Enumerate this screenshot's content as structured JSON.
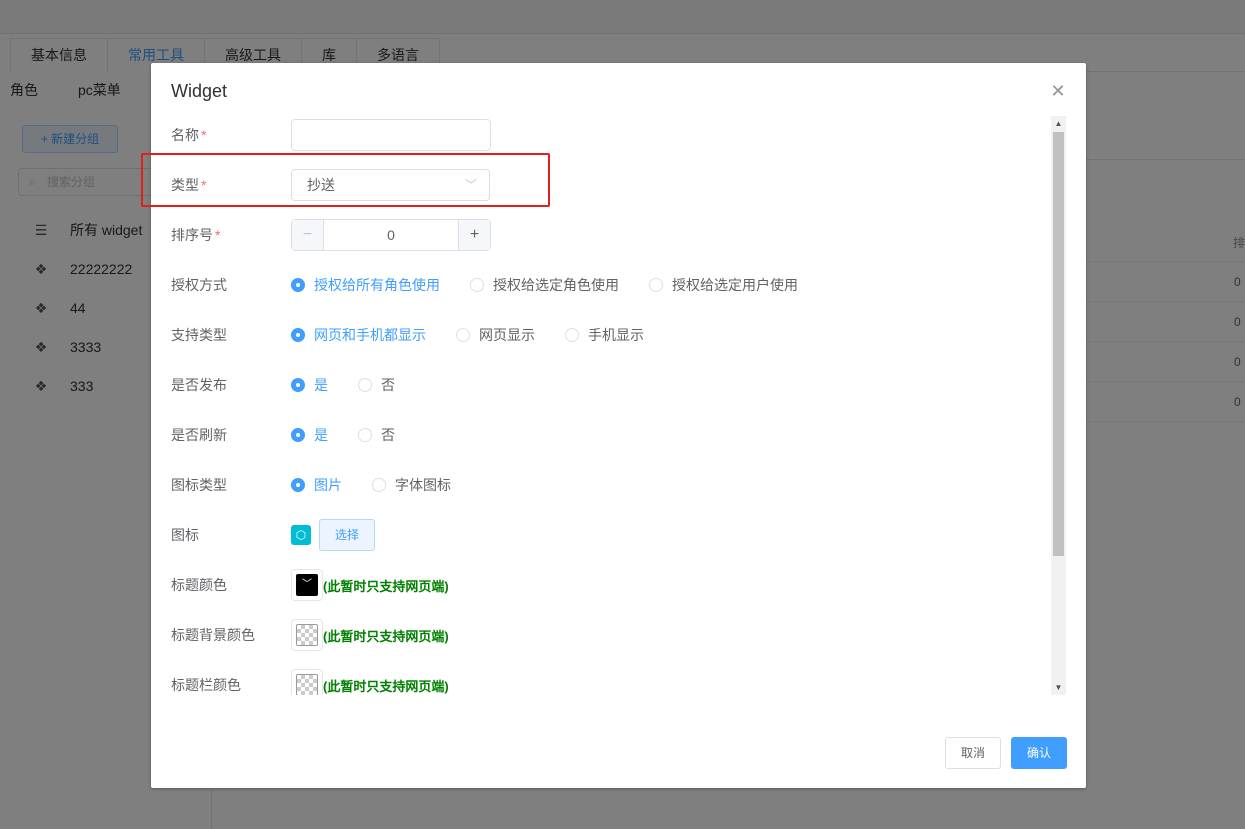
{
  "background": {
    "tabs": [
      "基本信息",
      "常用工具",
      "高级工具",
      "库",
      "多语言"
    ],
    "active_tab_index": 1,
    "subtabs": [
      "角色",
      "pc菜单"
    ],
    "new_group_label": "+ 新建分组",
    "search_placeholder": "搜索分组",
    "tree_items": [
      "所有 widget",
      "22222222",
      "44",
      "3333",
      "333"
    ],
    "column_header_partial": "排",
    "cell_values": [
      "0",
      "0",
      "0",
      "0"
    ]
  },
  "dialog": {
    "title": "Widget",
    "fields": {
      "name": {
        "label": "名称",
        "value": ""
      },
      "type": {
        "label": "类型",
        "value": "抄送"
      },
      "sort": {
        "label": "排序号",
        "value": "0",
        "minus": "−",
        "plus": "+"
      },
      "auth": {
        "label": "授权方式",
        "options": [
          "授权给所有角色使用",
          "授权给选定角色使用",
          "授权给选定用户使用"
        ],
        "selected": 0
      },
      "support": {
        "label": "支持类型",
        "options": [
          "网页和手机都显示",
          "网页显示",
          "手机显示"
        ],
        "selected": 0
      },
      "publish": {
        "label": "是否发布",
        "options": [
          "是",
          "否"
        ],
        "selected": 0
      },
      "refresh": {
        "label": "是否刷新",
        "options": [
          "是",
          "否"
        ],
        "selected": 0
      },
      "icon_type": {
        "label": "图标类型",
        "options": [
          "图片",
          "字体图标"
        ],
        "selected": 0
      },
      "icon": {
        "label": "图标",
        "button": "选择"
      },
      "title_color": {
        "label": "标题颜色",
        "note": "(此暂时只支持网页端)"
      },
      "title_bg_color": {
        "label": "标题背景颜色",
        "note": "(此暂时只支持网页端)"
      },
      "title_bar_color": {
        "label": "标题栏颜色",
        "note": "(此暂时只支持网页端)"
      }
    },
    "required_mark": "*",
    "cancel_label": "取消",
    "ok_label": "确认"
  },
  "colors": {
    "primary": "#409eff",
    "required": "#f56c6c",
    "note": "#008000",
    "highlight": "#e02020"
  }
}
